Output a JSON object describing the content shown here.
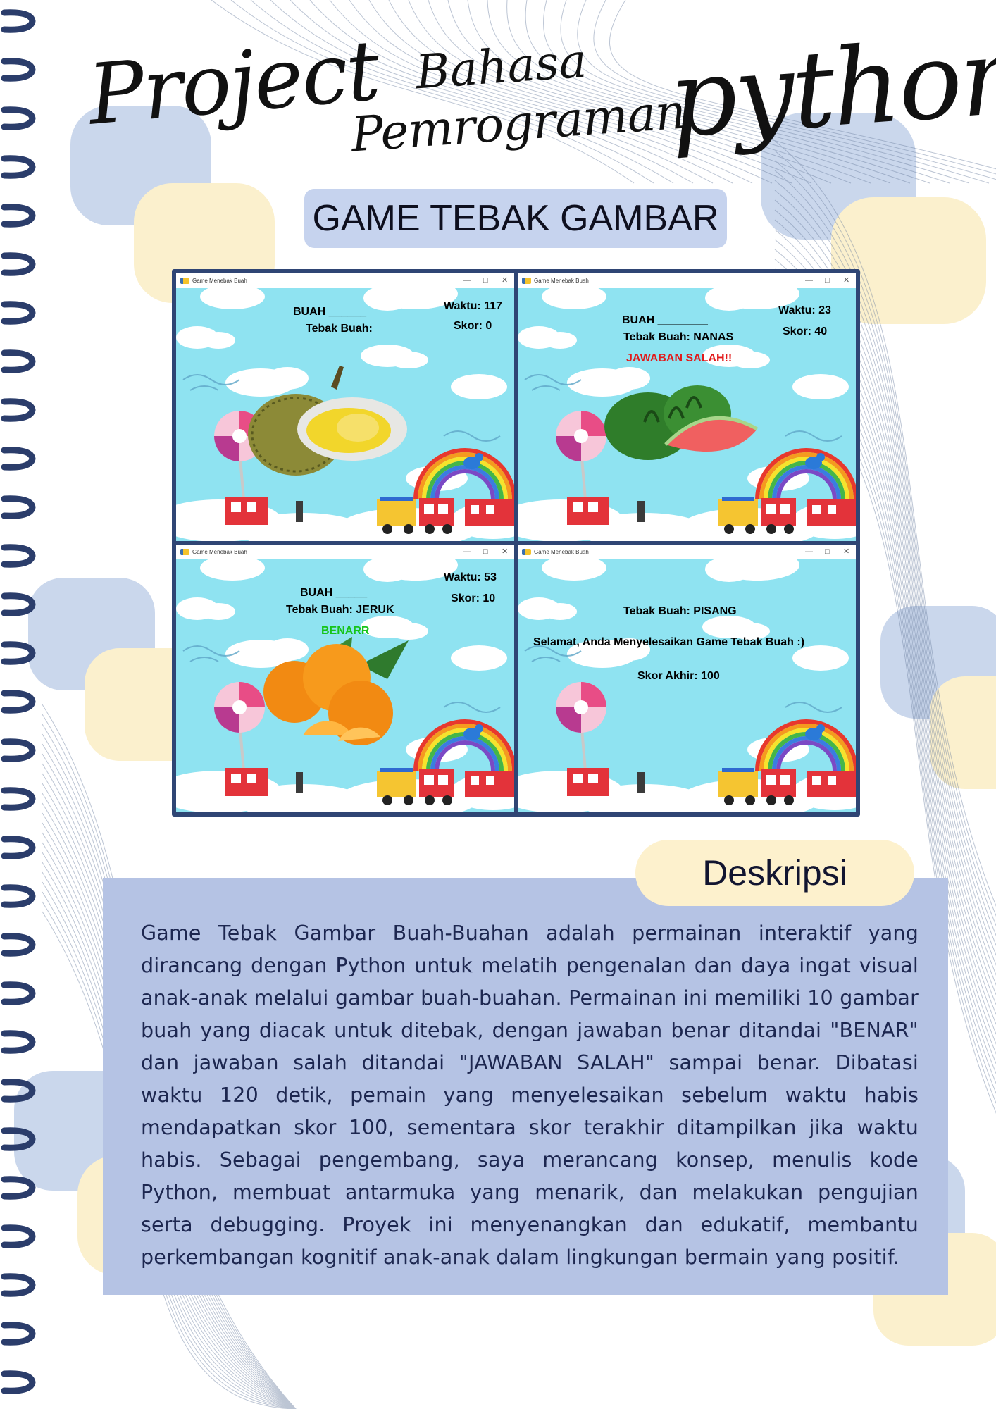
{
  "header": {
    "word_project": "Project",
    "word_bahasa": "Bahasa",
    "word_pemrograman": "Pemrograman",
    "word_python": "python"
  },
  "game_title": "GAME TEBAK GAMBAR",
  "screenshots": [
    {
      "window_title": "Game Menebak Buah",
      "waktu": "Waktu: 117",
      "skor": "Skor: 0",
      "buah_hint": "BUAH ______",
      "tebak": "Tebak Buah:",
      "fruit_icon": "durian-image"
    },
    {
      "window_title": "Game Menebak Buah",
      "waktu": "Waktu: 23",
      "skor": "Skor: 40",
      "buah_hint": "BUAH ________",
      "tebak": "Tebak Buah: NANAS",
      "feedback": "JAWABAN SALAH!!",
      "fruit_icon": "watermelon-image"
    },
    {
      "window_title": "Game Menebak Buah",
      "waktu": "Waktu: 53",
      "skor": "Skor: 10",
      "buah_hint": "BUAH _____",
      "tebak": "Tebak Buah: JERUK",
      "feedback": "BENARR",
      "fruit_icon": "orange-image"
    },
    {
      "window_title": "Game Menebak Buah",
      "tebak": "Tebak Buah: PISANG",
      "message": "Selamat, Anda Menyelesaikan Game Tebak Buah :)",
      "skor_akhir": "Skor Akhir: 100"
    }
  ],
  "window_controls": {
    "minimize": "—",
    "maximize": "□",
    "close": "✕"
  },
  "description": {
    "heading": "Deskripsi",
    "body": "Game Tebak Gambar Buah-Buahan adalah permainan interaktif yang dirancang dengan Python untuk melatih pengenalan dan daya ingat visual anak-anak melalui gambar buah-buahan. Permainan ini memiliki 10 gambar buah yang diacak untuk ditebak, dengan jawaban benar ditandai \"BENAR\" dan jawaban salah ditandai \"JAWABAN SALAH\" sampai benar. Dibatasi waktu 120 detik, pemain yang menyelesaikan sebelum waktu habis mendapatkan skor 100, sementara skor terakhir ditampilkan jika waktu habis. Sebagai pengembang, saya merancang konsep, menulis kode Python, membuat antarmuka yang menarik, dan melakukan pengujian serta debugging. Proyek ini menyenangkan dan edukatif, membantu perkembangan kognitif anak-anak dalam lingkungan bermain yang positif."
  },
  "colors": {
    "title_box": "#c6d3ee",
    "grid_frame": "#2f4574",
    "desc_box": "#b5c3e4",
    "desc_tab": "#fdf1cd",
    "text_dark": "#1d2750",
    "ring": "#2b3d6b",
    "sky": "#8fe3f1"
  }
}
